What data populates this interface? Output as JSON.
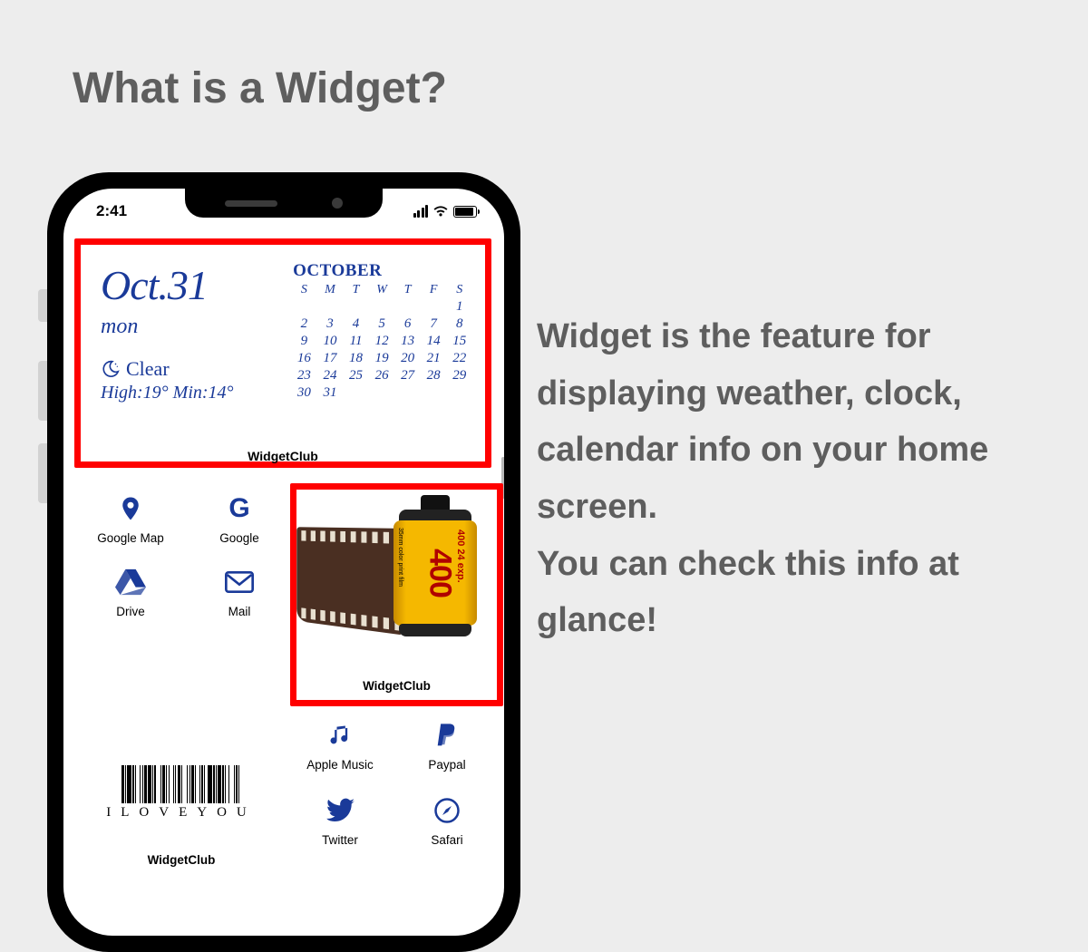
{
  "page_title": "What is a Widget?",
  "description": "Widget is the feature for displaying weather, clock, calendar info on your home screen.\nYou can check this info at glance!",
  "status": {
    "time": "2:41"
  },
  "calendar_widget": {
    "date": "Oct.31",
    "day": "mon",
    "weather": "Clear",
    "hilow": "High:19° Min:14°",
    "month": "OCTOBER",
    "dow": [
      "S",
      "M",
      "T",
      "W",
      "T",
      "F",
      "S"
    ],
    "weeks": [
      [
        "",
        "",
        "",
        "",
        "",
        "",
        "1"
      ],
      [
        "2",
        "3",
        "4",
        "5",
        "6",
        "7",
        "8"
      ],
      [
        "9",
        "10",
        "11",
        "12",
        "13",
        "14",
        "15"
      ],
      [
        "16",
        "17",
        "18",
        "19",
        "20",
        "21",
        "22"
      ],
      [
        "23",
        "24",
        "25",
        "26",
        "27",
        "28",
        "29"
      ],
      [
        "30",
        "31",
        "",
        "",
        "",
        "",
        ""
      ]
    ],
    "today": "31",
    "label": "WidgetClub"
  },
  "apps_top": [
    {
      "name": "Google Map",
      "icon": "pin"
    },
    {
      "name": "Google",
      "icon": "G"
    },
    {
      "name": "Drive",
      "icon": "drive"
    },
    {
      "name": "Mail",
      "icon": "mail"
    }
  ],
  "film_widget": {
    "label": "WidgetClub",
    "iso": "400",
    "exp_label": "400 24 exp.",
    "type_label": "35mm color print film"
  },
  "barcode_widget": {
    "text": "ILOVEYOU",
    "label": "WidgetClub"
  },
  "apps_bottom": [
    {
      "name": "Apple Music",
      "icon": "music"
    },
    {
      "name": "Paypal",
      "icon": "paypal"
    },
    {
      "name": "Twitter",
      "icon": "twitter"
    },
    {
      "name": "Safari",
      "icon": "safari"
    }
  ]
}
